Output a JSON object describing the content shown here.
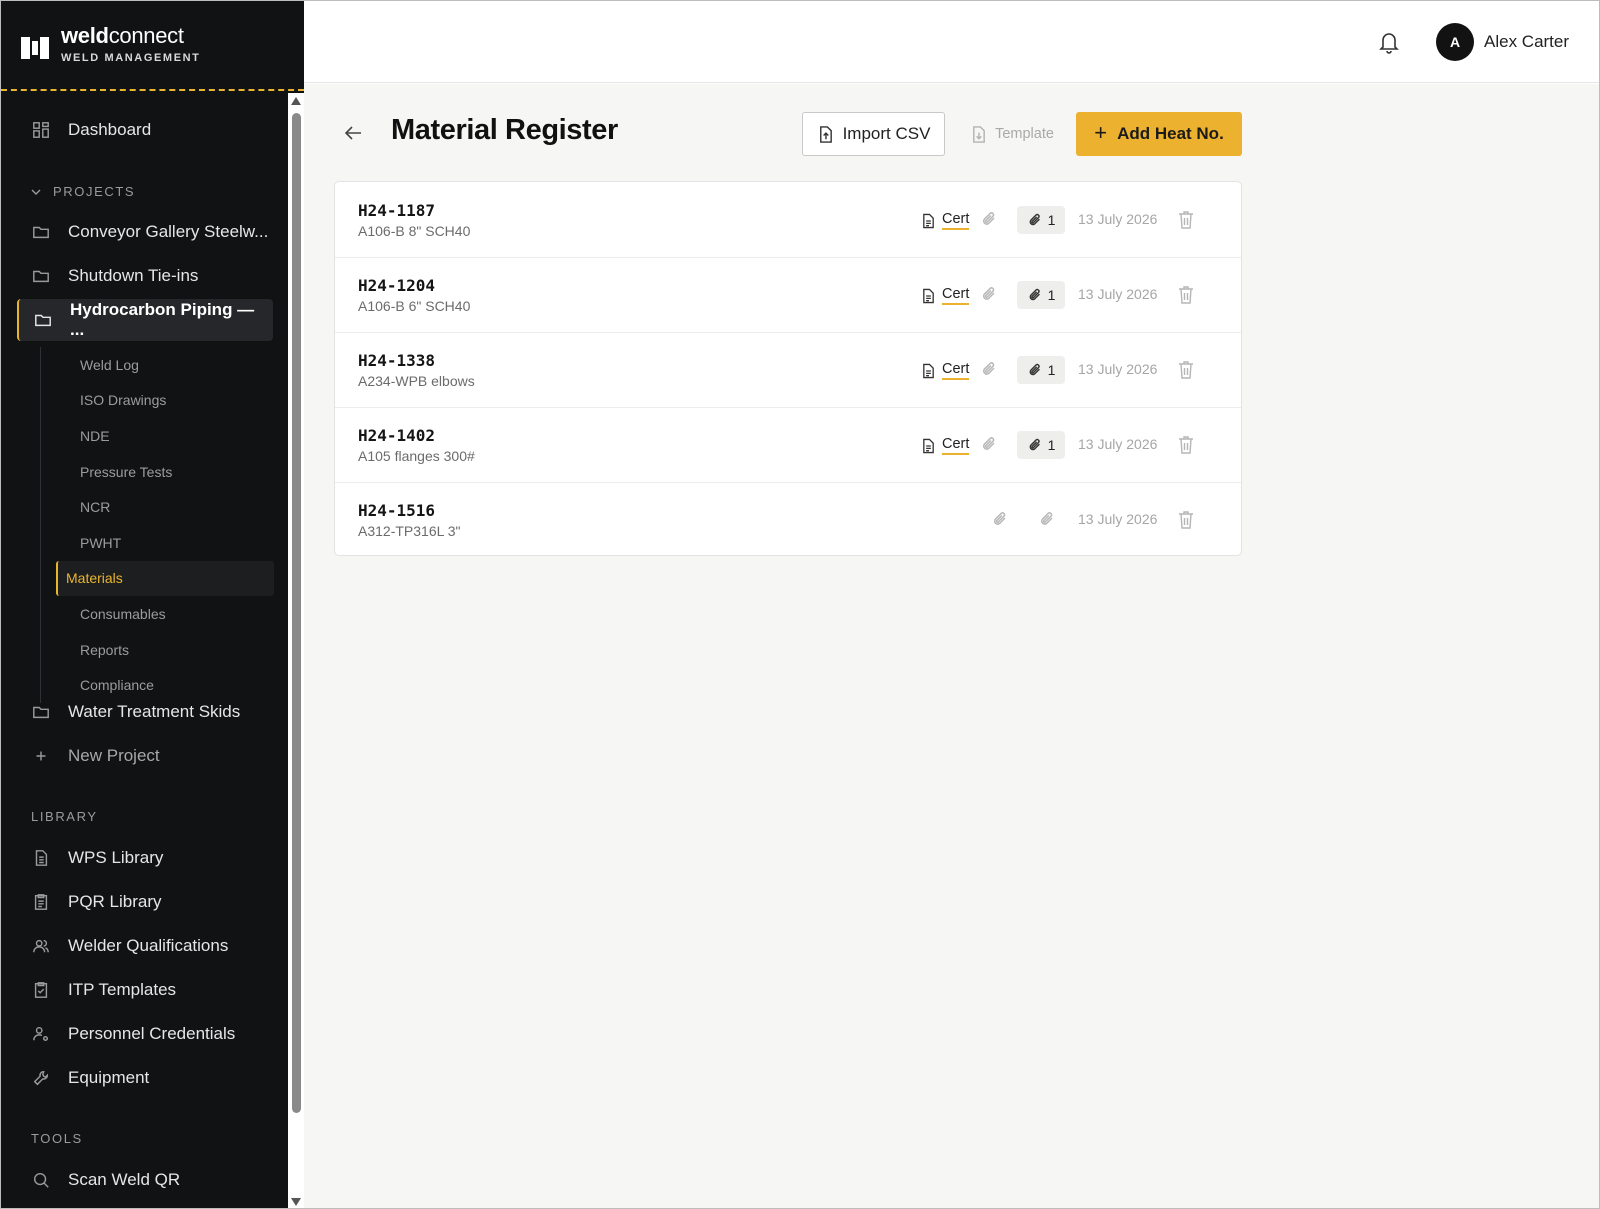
{
  "brand": {
    "name_bold": "weld",
    "name_rest": "connect",
    "subtitle": "WELD MANAGEMENT"
  },
  "header": {
    "avatar_initial": "A",
    "user_name": "Alex Carter"
  },
  "sidebar": {
    "dashboard": "Dashboard",
    "projects_label": "PROJECTS",
    "projects": [
      {
        "label": "Conveyor Gallery Steelw..."
      },
      {
        "label": "Shutdown Tie-ins"
      },
      {
        "label": "Hydrocarbon Piping — ..."
      },
      {
        "label": "Water Treatment Skids"
      }
    ],
    "sub_items": [
      {
        "label": "Weld Log"
      },
      {
        "label": "ISO Drawings"
      },
      {
        "label": "NDE"
      },
      {
        "label": "Pressure Tests"
      },
      {
        "label": "NCR"
      },
      {
        "label": "PWHT"
      },
      {
        "label": "Materials"
      },
      {
        "label": "Consumables"
      },
      {
        "label": "Reports"
      },
      {
        "label": "Compliance"
      }
    ],
    "new_project": "New Project",
    "library_label": "LIBRARY",
    "library": [
      {
        "label": "WPS Library"
      },
      {
        "label": "PQR Library"
      },
      {
        "label": "Welder Qualifications"
      },
      {
        "label": "ITP Templates"
      },
      {
        "label": "Personnel Credentials"
      },
      {
        "label": "Equipment"
      }
    ],
    "tools_label": "TOOLS",
    "tools": [
      {
        "label": "Scan Weld QR"
      }
    ]
  },
  "main": {
    "title": "Material Register",
    "import_label": "Import CSV",
    "template_label": "Template",
    "add_label": "Add Heat No.",
    "add_plus": "+",
    "rows": [
      {
        "heat": "H24-1187",
        "desc": "A106-B 8\" SCH40",
        "cert": "Cert",
        "count": "1",
        "date": "13 July 2026"
      },
      {
        "heat": "H24-1204",
        "desc": "A106-B 6\" SCH40",
        "cert": "Cert",
        "count": "1",
        "date": "13 July 2026"
      },
      {
        "heat": "H24-1338",
        "desc": "A234-WPB elbows",
        "cert": "Cert",
        "count": "1",
        "date": "13 July 2026"
      },
      {
        "heat": "H24-1402",
        "desc": "A105 flanges 300#",
        "cert": "Cert",
        "count": "1",
        "date": "13 July 2026"
      },
      {
        "heat": "H24-1516",
        "desc": "A312-TP316L 3\"",
        "date": "13 July 2026"
      }
    ]
  },
  "colors": {
    "accent": "#ecb22f",
    "sidebar_bg": "#111213",
    "main_bg": "#f6f6f4"
  }
}
